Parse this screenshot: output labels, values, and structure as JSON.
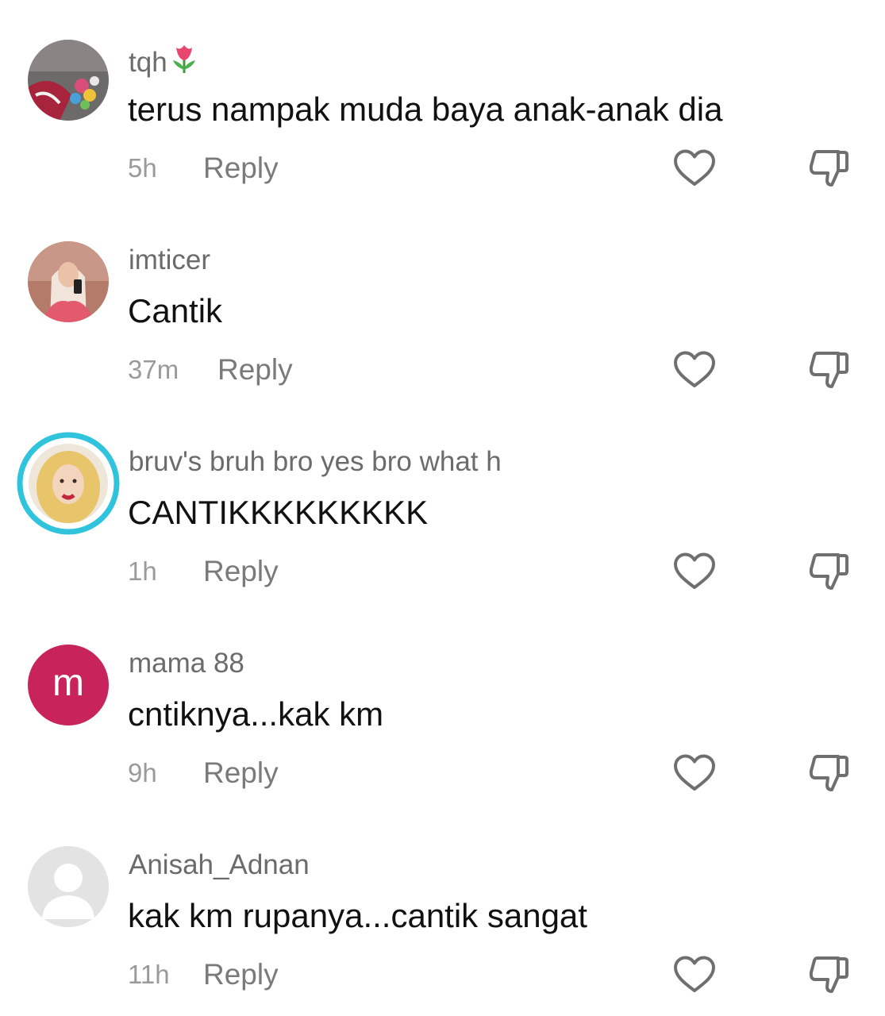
{
  "comments": [
    {
      "username": "tqh",
      "username_emoji": "tulip-emoji",
      "text": "terus nampak muda baya anak-anak dia",
      "time": "5h",
      "reply_label": "Reply",
      "avatar": "photo"
    },
    {
      "username": "imticer",
      "text": "Cantik",
      "time": "37m",
      "reply_label": "Reply",
      "avatar": "photo"
    },
    {
      "username": "bruv's bruh bro yes bro what h",
      "text": "CANTIKKKKKKKKK",
      "time": "1h",
      "reply_label": "Reply",
      "avatar": "photo-with-story-ring"
    },
    {
      "username": "mama 88",
      "text": "cntiknya...kak km",
      "time": "9h",
      "reply_label": "Reply",
      "avatar": "letter",
      "avatar_letter": "m"
    },
    {
      "username": "Anisah_Adnan",
      "text": "kak km rupanya...cantik sangat",
      "time": "11h",
      "reply_label": "Reply",
      "avatar": "default-person"
    }
  ],
  "icons": {
    "like": "heart-outline-icon",
    "dislike": "thumbs-down-outline-icon"
  },
  "colors": {
    "text_primary": "#111111",
    "username": "#6b6b6b",
    "time": "#9a9a9a",
    "reply": "#7a7a7a",
    "icon": "#6f6f6f",
    "story_ring": "#2fc4dc",
    "letter_avatar_bg": "#c8235a"
  }
}
